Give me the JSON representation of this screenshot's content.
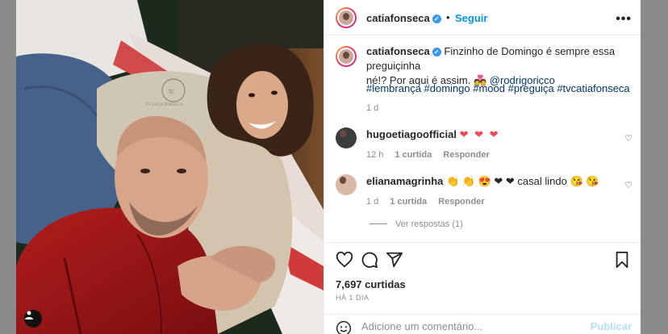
{
  "post": {
    "author": "catiafonseca",
    "follow_label": "Seguir",
    "more_label": "•••",
    "caption_line1": "Finzinho de Domingo é sempre essa preguiçinha",
    "caption_line2": "né!? Por aqui é assim. ",
    "caption_emoji": "💑",
    "caption_mention": "@rodrigoricco",
    "hashtags": "#lembrança #domingo #mood #preguiça #tvcatiafonseca",
    "caption_age": "1 d",
    "likes": "7,697 curtidas",
    "date": "HÁ 1 DIA",
    "photo_watermark": "TV CATIA FONSECA"
  },
  "comments": [
    {
      "user": "hugoetiagoofficial",
      "text": "❤ ❤ ❤",
      "age": "12 h",
      "likes": "1 curtida",
      "reply": "Responder"
    },
    {
      "user": "elianamagrinha",
      "text": "👏 👏 😍 ❤ ❤ casal lindo 😘 😘",
      "age": "1 d",
      "likes": "1 curtida",
      "reply": "Responder",
      "view_replies": "Ver respostas (1)"
    }
  ],
  "comment_box": {
    "placeholder": "Adicione um comentário...",
    "publish_label": "Publicar"
  },
  "colors": {
    "accent": "#0095f6",
    "heart": "#ed4956",
    "verified": "#3897f0"
  },
  "icons": [
    "heart-icon",
    "comment-icon",
    "share-icon",
    "bookmark-icon",
    "smile-icon",
    "more-icon",
    "verified-icon"
  ]
}
